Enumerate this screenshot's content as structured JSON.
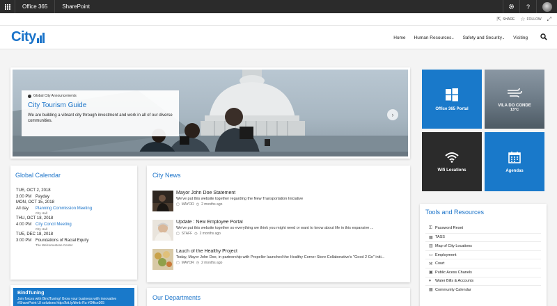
{
  "suite": {
    "app1": "Office 365",
    "app2": "SharePoint",
    "icons": [
      "waffle-icon",
      "gear-icon",
      "help-icon",
      "avatar"
    ]
  },
  "actions": {
    "share": "SHARE",
    "follow": "FOLLOW"
  },
  "header": {
    "logo": "City",
    "nav": [
      "Home",
      "Human Resources",
      "Safety and Security",
      "Visiting"
    ]
  },
  "hero": {
    "category": "Global City Announcements",
    "title": "City Tourism Guide",
    "description": "We are building a vibrant city through investment and work in all of our diverse communities."
  },
  "tiles": [
    {
      "label": "Office 365 Portal",
      "icon": "windows-icon"
    },
    {
      "label": "VILA DO CONDE",
      "sub": "13°C",
      "icon": "wind-icon"
    },
    {
      "label": "Wifi Locations",
      "icon": "wifi-icon"
    },
    {
      "label": "Agendas",
      "icon": "calendar-icon"
    }
  ],
  "calendar": {
    "title": "Global Calendar",
    "days": [
      {
        "date": "TUE, OCT 2, 2018",
        "events": [
          {
            "time": "3:00 PM",
            "title": "Payday",
            "link": false,
            "location": ""
          }
        ]
      },
      {
        "date": "MON, OCT 15, 2018",
        "events": [
          {
            "time": "All day",
            "title": "Planning Commission Meeting",
            "link": true,
            "location": "City Hall"
          }
        ]
      },
      {
        "date": "THU, OCT 18, 2018",
        "events": [
          {
            "time": "4:00 PM",
            "title": "City Concil Meeting",
            "link": true,
            "location": "City Hall"
          }
        ]
      },
      {
        "date": "TUE, DEC 18, 2018",
        "events": [
          {
            "time": "3:00 PM",
            "title": "Foundations of Racial Equity",
            "link": false,
            "location": "The Welcomestone Center"
          }
        ]
      }
    ]
  },
  "bindtuning": {
    "title": "BindTuning",
    "text": "Join forces with BindTuning! Grow your business with innovative #SharePoint UI solutions http://bit.ly/bhnb Ru #Office365"
  },
  "news": {
    "title": "City News",
    "items": [
      {
        "headline": "Mayor John Doe Statement",
        "text": "We've put this website together regarding the New Transportation Iniciative",
        "tag": "MAYOR",
        "time": "2 months ago"
      },
      {
        "headline": "Update : New Employee Portal",
        "text": "We've put this website together so everything we think you might need or want to know about life in this expansive ...",
        "tag": "STAFF",
        "time": "2 months ago"
      },
      {
        "headline": "Lauch of the Healthy Project",
        "text": "Today, Mayor John Doe, in partnership with Propeller launched the Healthy Corner Store Collaborative's \"Good 2 Go\" initi...",
        "tag": "MAYOR",
        "time": "2 months ago"
      }
    ]
  },
  "departments": {
    "title": "Our Departments"
  },
  "tools": {
    "title": "Tools and Resources",
    "items": [
      {
        "label": "Password Reset",
        "icon": "key-icon"
      },
      {
        "label": "TASS",
        "icon": "calendar-icon"
      },
      {
        "label": "Map of City Locations",
        "icon": "map-icon"
      },
      {
        "label": "Employment",
        "icon": "id-card-icon"
      },
      {
        "label": "Court",
        "icon": "gavel-icon"
      },
      {
        "label": "Public Acess Chanels",
        "icon": "tv-icon"
      },
      {
        "label": "Water Bills & Accounts",
        "icon": "drop-icon"
      },
      {
        "label": "Community Calendar",
        "icon": "calendar-icon"
      }
    ]
  },
  "colors": {
    "accent": "#1a73c9",
    "tile_blue": "#1979ca",
    "tile_dark": "#2b2b2b",
    "suitebar": "#2b2b2b"
  }
}
